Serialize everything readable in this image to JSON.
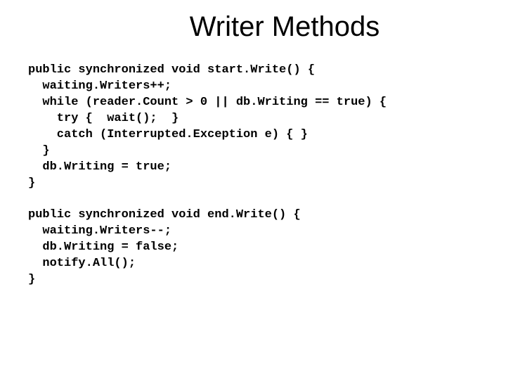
{
  "title": "Writer Methods",
  "code": {
    "l01": "public synchronized void start.Write() {",
    "l02": "  waiting.Writers++;",
    "l03": "  while (reader.Count > 0 || db.Writing == true) {",
    "l04": "    try {  wait();  }",
    "l05": "    catch (Interrupted.Exception e) { }",
    "l06": "  }",
    "l07": "  db.Writing = true;",
    "l08": "}",
    "l09": "",
    "l10": "public synchronized void end.Write() {",
    "l11": "  waiting.Writers--;",
    "l12": "  db.Writing = false;",
    "l13": "  notify.All();",
    "l14": "}"
  }
}
